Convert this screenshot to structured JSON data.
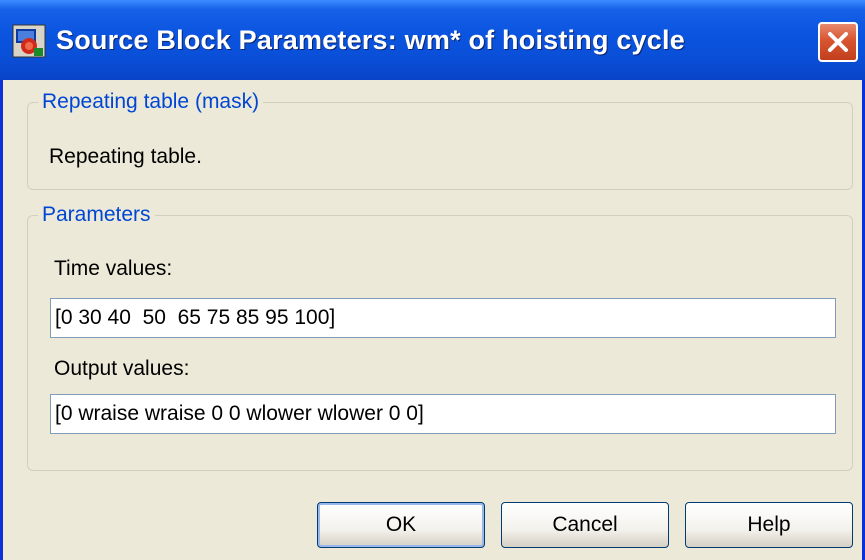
{
  "window": {
    "title": "Source Block Parameters: wm* of hoisting cycle",
    "icon": "simulink-block-icon",
    "close_icon": "close-icon"
  },
  "mask_group": {
    "legend": "Repeating table (mask)",
    "description": "Repeating table."
  },
  "params_group": {
    "legend": "Parameters",
    "time_label": "Time values:",
    "time_value": "[0 30 40  50  65 75 85 95 100]",
    "output_label": "Output values:",
    "output_value": "[0 wraise wraise 0 0 wlower wlower 0 0]"
  },
  "buttons": {
    "ok": "OK",
    "cancel": "Cancel",
    "help": "Help"
  },
  "colors": {
    "titlebar": "#0b55e0",
    "group_legend": "#0046d5",
    "dialog_bg": "#ece9d8",
    "close_button": "#d9542f"
  }
}
